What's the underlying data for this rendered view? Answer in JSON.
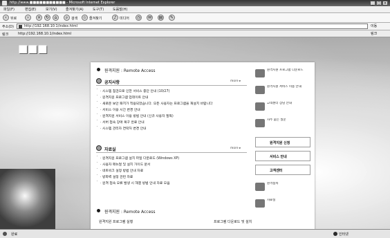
{
  "window": {
    "title": "http://www.■■■■■■■■■■■ - Microsoft Internet Explorer"
  },
  "menu": [
    "파일(F)",
    "편집(E)",
    "보기(V)",
    "즐겨찾기(A)",
    "도구(T)",
    "도움말(H)"
  ],
  "toolbar": {
    "back": "뒤로",
    "search": "검색",
    "favorites": "즐겨찾기",
    "media": "미디어"
  },
  "address": {
    "label": "주소(D)",
    "url": "http://192.168.10.1/index.html",
    "go": "이동"
  },
  "links": {
    "label": "링크",
    "text": "http://192.168.10.1/index.html",
    "right": "링크"
  },
  "logo": "■■■",
  "card": {
    "header1": "원격지원 : Remote Access",
    "notice": {
      "title": "공지사항",
      "more": "more ▸",
      "items": [
        "· 시스템 점검으로 인한 서비스 중단 안내 (10/27)",
        "· 원격지원 프로그램 업데이트 안내",
        "· 새로운 보안 패치가 적용되었습니다. 모든 사용자는 프로그램을 재설치 바랍니다",
        "· 서비스 이용 시간 변경 안내",
        "· 원격지원 서비스 이용 방법 안내 (신규 사용자 필독)",
        "· 서버 접속 장애 복구 완료 안내",
        "· 시스템 관리자 연락처 변경 안내"
      ]
    },
    "news": {
      "title": "자료실",
      "more": "more ▸",
      "items": [
        "· 원격지원 프로그램 설치 파일 다운로드 (Windows XP)",
        "· 사용자 매뉴얼 및 설치 가이드 문서",
        "· 네트워크 설정 방법 안내 자료",
        "· 방화벽 설정 관련 자료",
        "· 원격 접속 오류 발생 시 해결 방법 안내 자료 모음"
      ]
    },
    "header2": "원격지원 : Remote Access",
    "bottom_left": "원격지원 프로그램 실행",
    "bottom_right": "프로그램 다운로드 및 설치"
  },
  "right_col": [
    {
      "text": "원격지원 프로그램 다운로드"
    },
    {
      "text": "원격지원 서비스 이용 안내"
    },
    {
      "text": "고객센터 상담 안내"
    },
    {
      "text": "자주 묻는 질문"
    }
  ],
  "right_boxes": [
    "원격지원 신청",
    "서비스 안내",
    "고객센터"
  ],
  "right_bottom": [
    "원격접속",
    "자료실"
  ],
  "status": {
    "left": "완료",
    "zone": "인터넷"
  }
}
